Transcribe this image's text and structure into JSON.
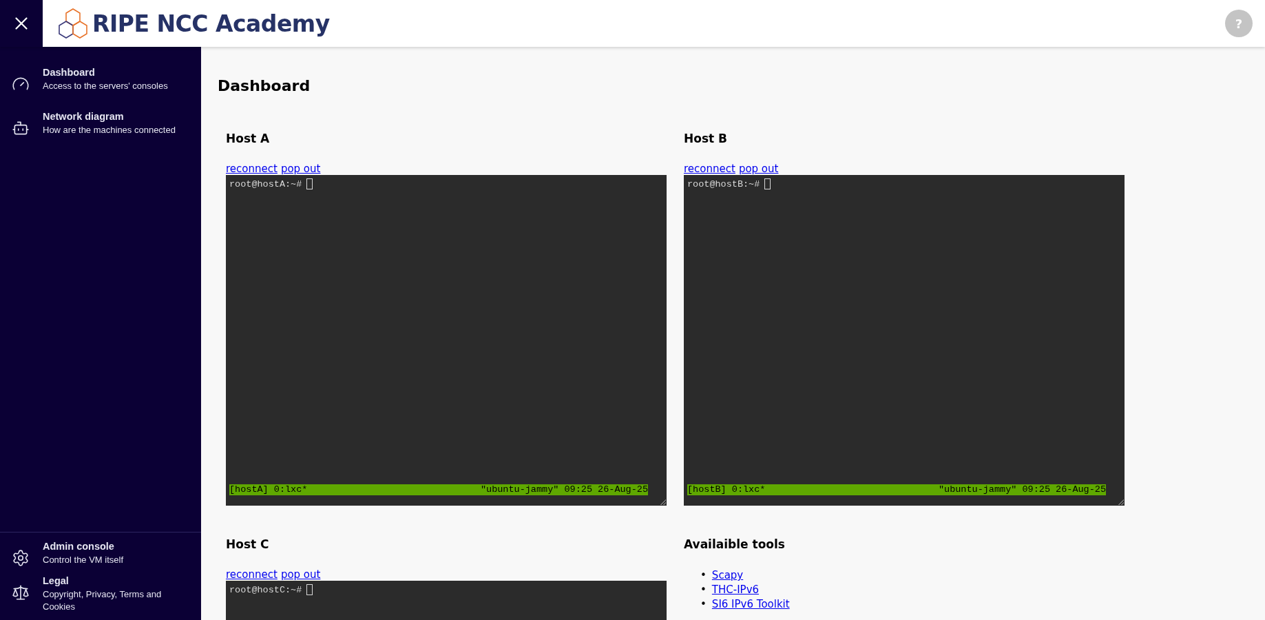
{
  "header": {
    "title": "RIPE NCC Academy",
    "help": "?"
  },
  "sidebar": {
    "top": [
      {
        "kind": "gauge",
        "title": "Dashboard",
        "subtitle": "Access to the servers' consoles"
      },
      {
        "kind": "astronaut",
        "title": "Network diagram",
        "subtitle": "How are the machines connected"
      }
    ],
    "bottom": [
      {
        "kind": "gear",
        "title": "Admin console",
        "subtitle": "Control the VM itself"
      },
      {
        "kind": "scale",
        "title": "Legal",
        "subtitle": "Copyright, Privacy, Terms and Cookies"
      }
    ]
  },
  "page": {
    "title": "Dashboard"
  },
  "panels": [
    {
      "kind": "terminal",
      "title": "Host A",
      "links": [
        "reconnect",
        "pop out"
      ],
      "prompt": "root@hostA:~#",
      "status_left": "[hostA] 0:lxc*",
      "status_right": "\"ubuntu-jammy\" 09:25 26-Aug-25"
    },
    {
      "kind": "terminal",
      "title": "Host B",
      "links": [
        "reconnect",
        "pop out"
      ],
      "prompt": "root@hostB:~#",
      "status_left": "[hostB] 0:lxc*",
      "status_right": "\"ubuntu-jammy\" 09:25 26-Aug-25"
    },
    {
      "kind": "terminal",
      "title": "Host C",
      "links": [
        "reconnect",
        "pop out"
      ],
      "prompt": "root@hostC:~#"
    },
    {
      "kind": "tools",
      "title": "Availaible tools",
      "items": [
        {
          "bullet": "•",
          "label": "Scapy"
        },
        {
          "bullet": "•",
          "label": "THC-IPv6"
        },
        {
          "bullet": "•",
          "label": "SI6 IPv6 Toolkit"
        }
      ]
    }
  ]
}
